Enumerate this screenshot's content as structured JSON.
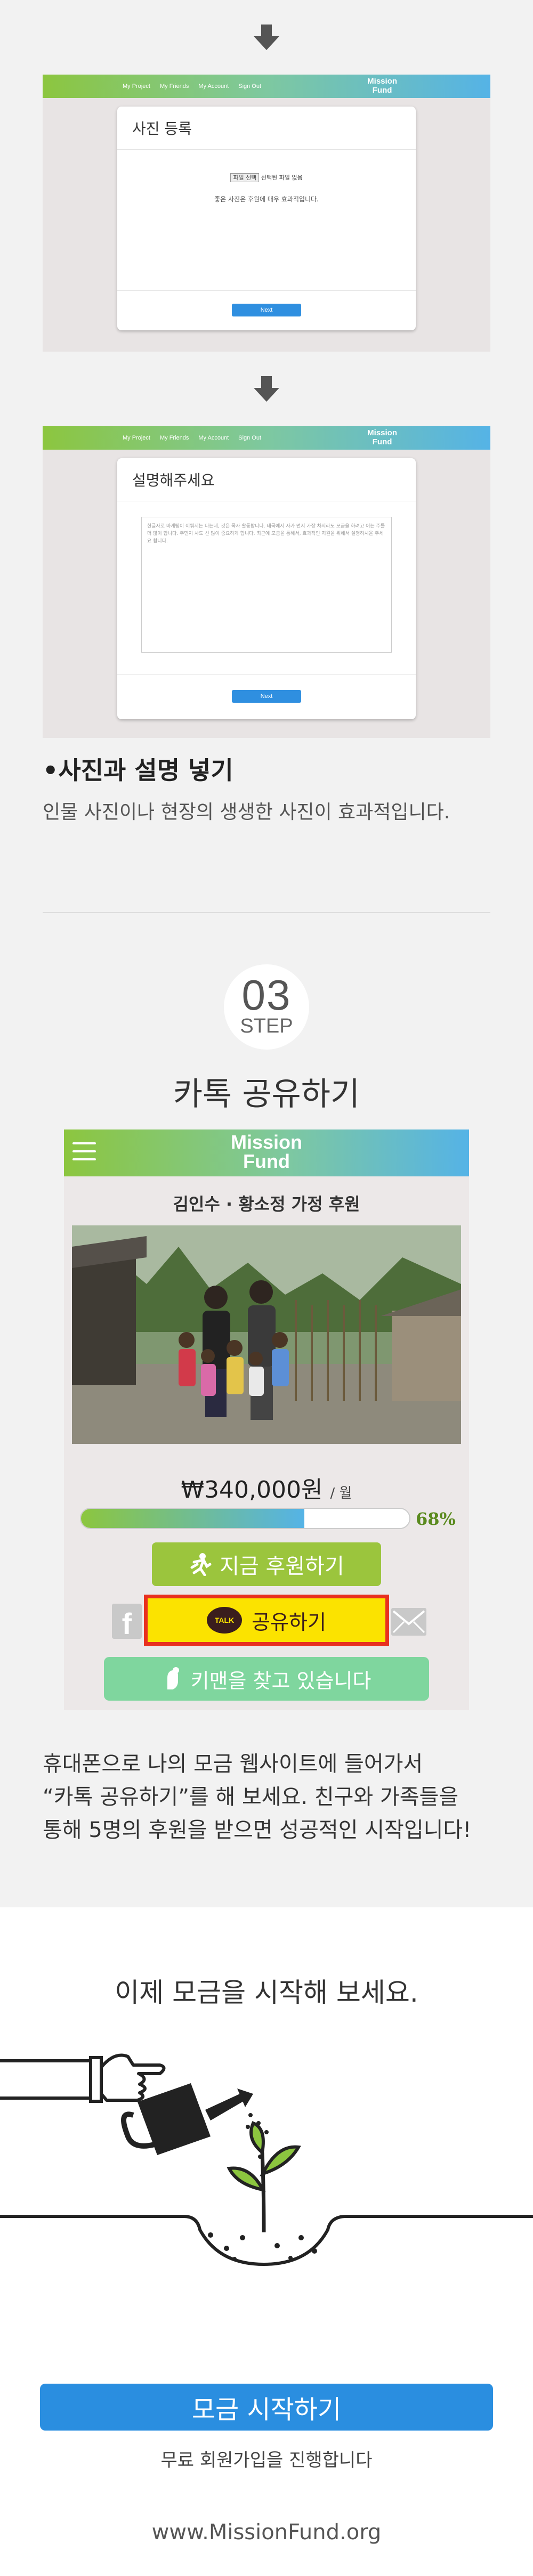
{
  "mockups": {
    "nav_items": [
      "My Project",
      "My Friends",
      "My Account",
      "Sign Out"
    ],
    "logo_line1": "Mission",
    "logo_line2": "Fund",
    "photo_card": {
      "title": "사진 등록",
      "file_button": "파일 선택",
      "file_status": "선택된 파일 없음",
      "hint": "좋은 사진은 후원에 매우 효과적입니다.",
      "next": "Next"
    },
    "desc_card": {
      "title": "설명해주세요",
      "placeholder": "한글자로 마케팅이 이뤄지는 다는데, 것은 목사 활동합니다. 태국에서 사가 먼지 가장 차지라도 모금을 하려고 어는 주를 더 많이 합니다. 주민지 사도 선 많이 중요하게 합니다. 최근에 모금을 통해서, 효과적인 지원을 위해서 설명하시을 주세요 합니다.",
      "next": "Next"
    }
  },
  "section_photo": {
    "heading": "•사진과 설명 넣기",
    "description": "인물 사진이나 현장의 생생한 사진이  효과적입니다."
  },
  "step3": {
    "number": "03",
    "label": "STEP",
    "title": "카톡 공유하기"
  },
  "phone": {
    "logo_line1": "Mission",
    "logo_line2": "Fund",
    "project_name": "김인수 · 황소정 가정 후원",
    "amount": "₩340,000원",
    "amount_unit": "/ 월",
    "progress_percent": "68%",
    "progress_value": 0.68,
    "donate_button": "지금 후원하기",
    "kakao_badge": "TALK",
    "kakao_button": "공유하기",
    "king_button": "키맨을 찾고 있습니다",
    "facebook_letter": "f"
  },
  "step3_paragraph": {
    "line1": "휴대폰으로 나의 모금 웹사이트에 들어가서",
    "line2": "“카톡 공유하기”를 해 보세요. 친구와 가족들을",
    "line3": "통해 5명의 후원을 받으면 성공적인 시작입니다!"
  },
  "cta": {
    "title": "이제 모금을 시작해 보세요.",
    "button": "모금 시작하기",
    "note": "무료 회원가입을 진행합니다",
    "url": "www.MissionFund.org"
  },
  "colors": {
    "brand_green": "#8cc63f",
    "brand_blue": "#55b3e6",
    "cta_blue": "#2a8ee0",
    "kakao_yellow": "#fbe300",
    "highlight_red": "#e8301f"
  },
  "icons": [
    "arrow-down-icon",
    "hamburger-icon",
    "running-person-icon",
    "kakao-talk-icon",
    "facebook-icon",
    "mail-icon",
    "key-hand-icon",
    "hand-pointing-icon",
    "watering-can-icon",
    "sprout-icon"
  ]
}
